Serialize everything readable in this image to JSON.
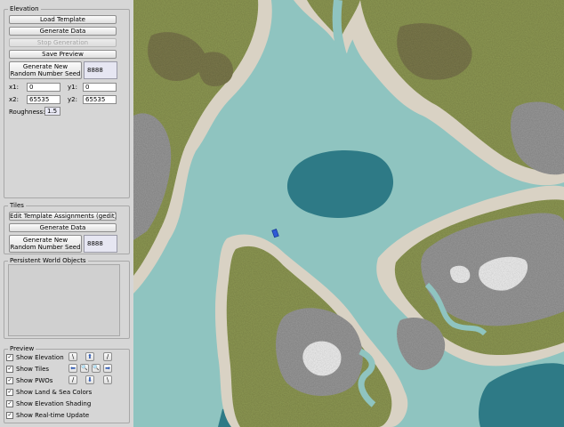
{
  "elevation": {
    "title": "Elevation",
    "load_template": "Load Template",
    "generate_data": "Generate Data",
    "stop_generation": "Stop Generation",
    "save_preview": "Save Preview",
    "seed_button": [
      "Generate New",
      "Random Number Seed"
    ],
    "seed_value": "8888",
    "x1_label": "x1:",
    "x1_value": "0",
    "y1_label": "y1:",
    "y1_value": "0",
    "x2_label": "x2:",
    "x2_value": "65535",
    "y2_label": "y2:",
    "y2_value": "65535",
    "roughness_label": "Roughness:",
    "roughness_value": "1.5"
  },
  "tiles": {
    "title": "Tiles",
    "edit_template": "Edit Template Assignments (gedit)",
    "generate_data": "Generate Data",
    "seed_button": [
      "Generate New",
      "Random Number Seed"
    ],
    "seed_value": "8888"
  },
  "pwo": {
    "title": "Persistent World Objects"
  },
  "preview": {
    "title": "Preview",
    "checkboxes": [
      {
        "label": "Show Elevation",
        "checked": true
      },
      {
        "label": "Show Tiles",
        "checked": true
      },
      {
        "label": "Show PWOs",
        "checked": true
      },
      {
        "label": "Show Land & Sea Colors",
        "checked": true
      },
      {
        "label": "Show Elevation Shading",
        "checked": true
      },
      {
        "label": "Show Real-time Update",
        "checked": true
      }
    ],
    "check_mark": "✓",
    "nav": {
      "nw": "\\",
      "up": "⬆",
      "ne": "/",
      "left": "⬅",
      "zoom_out": "🔍",
      "zoom_in": "🔍",
      "right": "➡",
      "sw": "/",
      "down": "⬇",
      "se": "\\"
    }
  },
  "colors": {
    "deep_water": "#2e7a86",
    "shallow_water": "#8fc4c0",
    "beach": "#d9d2c4",
    "grass": "#8f9a55",
    "forest": "#7d7a4e",
    "rock": "#9a9a9a",
    "snow": "#f2f2f2"
  }
}
